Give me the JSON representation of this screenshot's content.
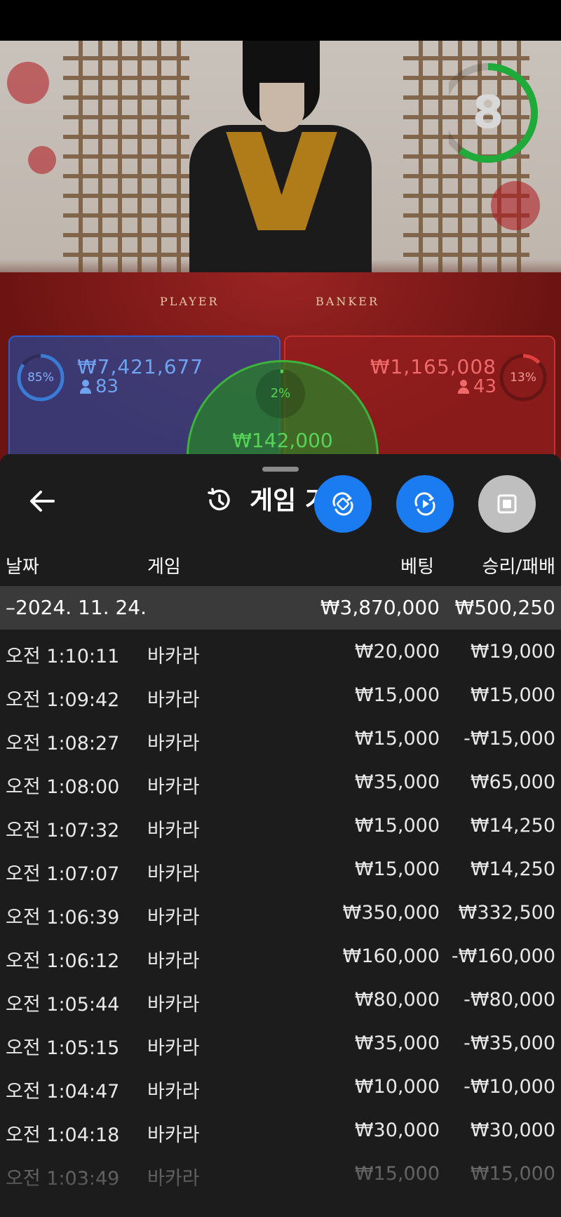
{
  "video": {
    "table_labels": {
      "player": "PLAYER",
      "banker": "BANKER"
    },
    "timer": {
      "value": "8",
      "fraction_remaining": 0.6,
      "color": "#1faa3a"
    },
    "player": {
      "percent": "85%",
      "percent_value": 0.85,
      "amount": "₩7,421,677",
      "count": "83",
      "color": "#3a7bd5"
    },
    "banker": {
      "percent": "13%",
      "percent_value": 0.13,
      "amount": "₩1,165,008",
      "count": "43",
      "color": "#e04040"
    },
    "tie": {
      "percent": "2%",
      "percent_value": 0.02,
      "amount": "₩142,000",
      "color": "#57d457"
    }
  },
  "sheet": {
    "title": "게임 기록",
    "buttons": {
      "back": "back-arrow-icon",
      "history": "history-icon",
      "fab1": "rotate-icon",
      "fab2": "replay-icon",
      "fab3": "stop-icon"
    },
    "columns": {
      "date": "날짜",
      "game": "게임",
      "bet": "베팅",
      "winloss": "승리/패배"
    },
    "date_group": {
      "date": "2024. 11. 24.",
      "collapse": "–",
      "total_bet": "₩3,870,000",
      "total_winloss": "₩500,250"
    },
    "rows": [
      {
        "time": "오전 1:10:11",
        "game": "바카라",
        "bet": "₩20,000",
        "winloss": "₩19,000"
      },
      {
        "time": "오전 1:09:42",
        "game": "바카라",
        "bet": "₩15,000",
        "winloss": "₩15,000"
      },
      {
        "time": "오전 1:08:27",
        "game": "바카라",
        "bet": "₩15,000",
        "winloss": "-₩15,000"
      },
      {
        "time": "오전 1:08:00",
        "game": "바카라",
        "bet": "₩35,000",
        "winloss": "₩65,000"
      },
      {
        "time": "오전 1:07:32",
        "game": "바카라",
        "bet": "₩15,000",
        "winloss": "₩14,250"
      },
      {
        "time": "오전 1:07:07",
        "game": "바카라",
        "bet": "₩15,000",
        "winloss": "₩14,250"
      },
      {
        "time": "오전 1:06:39",
        "game": "바카라",
        "bet": "₩350,000",
        "winloss": "₩332,500"
      },
      {
        "time": "오전 1:06:12",
        "game": "바카라",
        "bet": "₩160,000",
        "winloss": "-₩160,000"
      },
      {
        "time": "오전 1:05:44",
        "game": "바카라",
        "bet": "₩80,000",
        "winloss": "-₩80,000"
      },
      {
        "time": "오전 1:05:15",
        "game": "바카라",
        "bet": "₩35,000",
        "winloss": "-₩35,000"
      },
      {
        "time": "오전 1:04:47",
        "game": "바카라",
        "bet": "₩10,000",
        "winloss": "-₩10,000"
      },
      {
        "time": "오전 1:04:18",
        "game": "바카라",
        "bet": "₩30,000",
        "winloss": "₩30,000"
      },
      {
        "time": "오전 1:03:49",
        "game": "바카라",
        "bet": "₩15,000",
        "winloss": "₩15,000"
      }
    ]
  }
}
